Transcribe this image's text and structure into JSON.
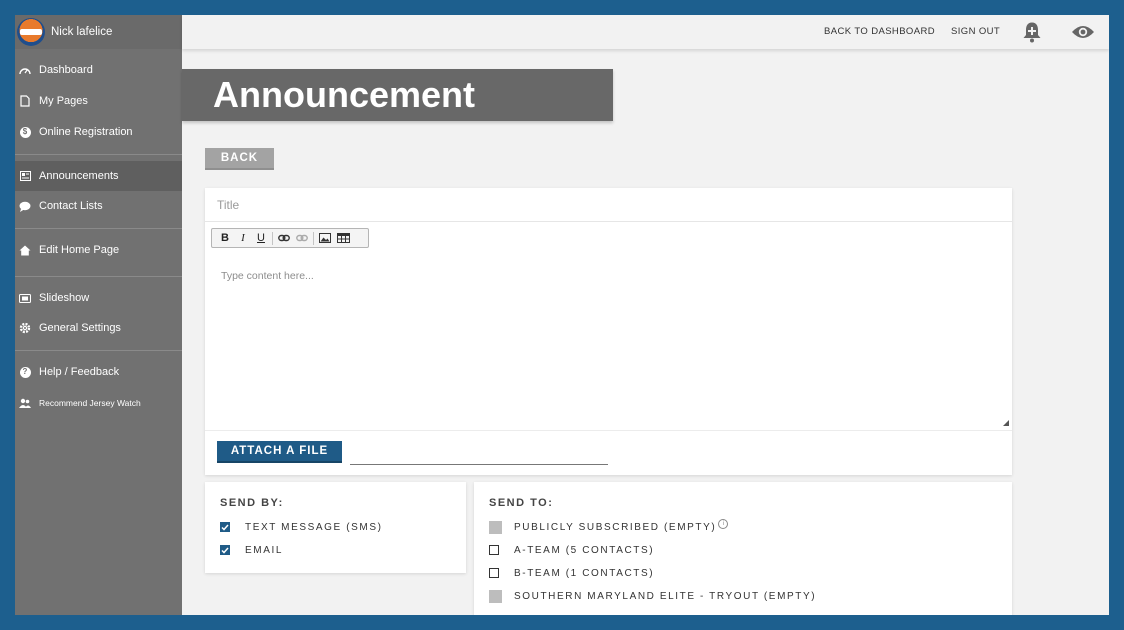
{
  "sidebar": {
    "user_name": "Nick lafelice",
    "items": [
      {
        "label": "Dashboard"
      },
      {
        "label": "My Pages"
      },
      {
        "label": "Online Registration"
      },
      {
        "label": "Announcements"
      },
      {
        "label": "Contact Lists"
      },
      {
        "label": "Edit Home Page"
      },
      {
        "label": "Slideshow"
      },
      {
        "label": "General Settings"
      },
      {
        "label": "Help / Feedback"
      },
      {
        "label": "Recommend Jersey Watch"
      }
    ],
    "active_item": "Announcements"
  },
  "header": {
    "back_to_dashboard": "BACK TO DASHBOARD",
    "sign_out": "SIGN OUT"
  },
  "page": {
    "title": "Announcement",
    "back_label": "BACK"
  },
  "editor": {
    "title_placeholder": "Title",
    "content_placeholder": "Type content here...",
    "attach_label": "ATTACH A FILE"
  },
  "send_by": {
    "heading": "SEND BY:",
    "options": [
      {
        "label": "TEXT MESSAGE (SMS)",
        "checked": true
      },
      {
        "label": "EMAIL",
        "checked": true
      }
    ]
  },
  "send_to": {
    "heading": "SEND TO:",
    "options": [
      {
        "label": "PUBLICLY SUBSCRIBED (EMPTY)",
        "state": "disabled"
      },
      {
        "label": "A-TEAM (5 CONTACTS)",
        "state": "unchecked"
      },
      {
        "label": "B-TEAM (1 CONTACTS)",
        "state": "unchecked"
      },
      {
        "label": "SOUTHERN MARYLAND ELITE - TRYOUT (EMPTY)",
        "state": "disabled"
      }
    ]
  },
  "colors": {
    "frame": "#1d5f8e",
    "sidebar": "#717171",
    "accent": "#1f5b87",
    "banner": "#686868"
  }
}
